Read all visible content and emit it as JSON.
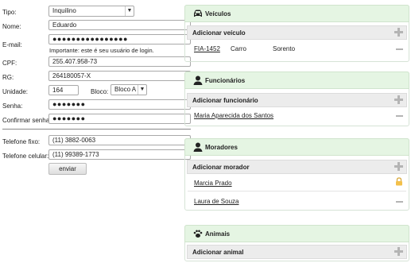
{
  "form": {
    "tipo_label": "Tipo:",
    "tipo_value": "Inquilino",
    "nome_label": "Nome:",
    "nome_value": "Eduardo",
    "email_label": "E-mail:",
    "email_value": "●●●●●●●●●●●●●●●●",
    "email_hint": "Importante: este é seu usuário de login.",
    "cpf_label": "CPF:",
    "cpf_value": "255.407.958-73",
    "rg_label": "RG:",
    "rg_value": "264180057-X",
    "unidade_label": "Unidade:",
    "unidade_value": "164",
    "bloco_label": "Bloco:",
    "bloco_value": "Bloco A",
    "senha_label": "Senha:",
    "senha_value": "●●●●●●●",
    "confirmar_label": "Confirmar senha:",
    "confirmar_value": "●●●●●●●",
    "tel_fixo_label": "Telefone fixo:",
    "tel_fixo_value": "(11) 3882-0063",
    "tel_cel_label": "Telefone celular:",
    "tel_cel_value": "(11) 99389-1773",
    "submit_label": "enviar"
  },
  "panels": {
    "veiculos": {
      "title": "Veículos",
      "add_label": "Adicionar veículo",
      "rows": [
        {
          "placa": "FIA-1452",
          "tipo": "Carro",
          "modelo": "Sorento"
        }
      ]
    },
    "funcionarios": {
      "title": "Funcionários",
      "add_label": "Adicionar funcionário",
      "rows": [
        {
          "name": "Maria Aparecida dos Santos"
        }
      ]
    },
    "moradores": {
      "title": "Moradores",
      "add_label": "Adicionar morador",
      "rows": [
        {
          "name": "Marcia Prado",
          "icon": "lock-icon"
        },
        {
          "name": "Laura de Souza",
          "icon": "minus-icon"
        }
      ]
    },
    "animais": {
      "title": "Animais",
      "add_label": "Adicionar animal"
    }
  }
}
